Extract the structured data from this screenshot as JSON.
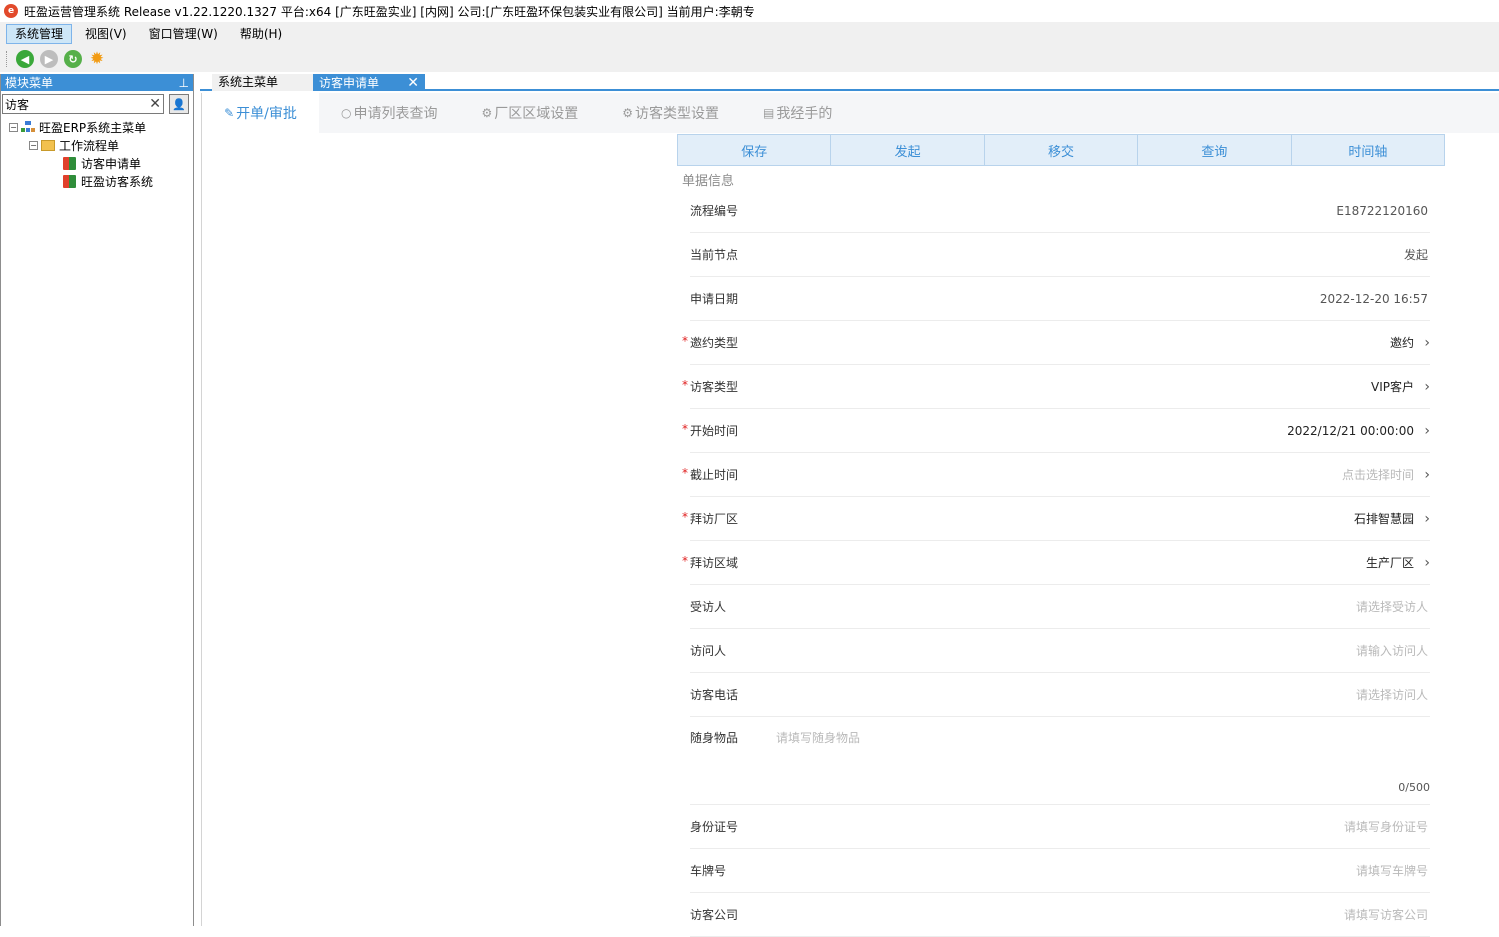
{
  "window": {
    "title": "旺盈运营管理系统 Release v1.22.1220.1327 平台:x64  [广东旺盈实业] [内网] 公司:[广东旺盈环保包装实业有限公司] 当前用户:李朝专"
  },
  "menubar": {
    "items": [
      "系统管理",
      "视图(V)",
      "窗口管理(W)",
      "帮助(H)"
    ]
  },
  "toolbar": {
    "icons": [
      "back-icon",
      "forward-icon",
      "refresh-icon",
      "gear-icon"
    ]
  },
  "left_panel": {
    "title": "模块菜单",
    "pin_glyph": "ᵽ",
    "search_value": "访客",
    "tree": {
      "root": "旺盈ERP系统主菜单",
      "folder": "工作流程单",
      "items": [
        "访客申请单",
        "旺盈访客系统"
      ]
    }
  },
  "doc_tabs": [
    "系统主菜单",
    "访客申请单"
  ],
  "subnav": [
    "开单/审批",
    "申请列表查询",
    "厂区区域设置",
    "访客类型设置",
    "我经手的"
  ],
  "actions": [
    "保存",
    "发起",
    "移交",
    "查询",
    "时间轴"
  ],
  "section_title": "单据信息",
  "form": {
    "flow_no": {
      "label": "流程编号",
      "value": "E18722120160"
    },
    "node": {
      "label": "当前节点",
      "value": "发起"
    },
    "apply_date": {
      "label": "申请日期",
      "value": "2022-12-20 16:57"
    },
    "invite_type": {
      "label": "邀约类型",
      "value": "邀约"
    },
    "visitor_type": {
      "label": "访客类型",
      "value": "VIP客户"
    },
    "start_time": {
      "label": "开始时间",
      "value": "2022/12/21 00:00:00"
    },
    "end_time": {
      "label": "截止时间",
      "placeholder": "点击选择时间"
    },
    "factory": {
      "label": "拜访厂区",
      "value": "石排智慧园"
    },
    "area": {
      "label": "拜访区域",
      "value": "生产厂区"
    },
    "host": {
      "label": "受访人",
      "placeholder": "请选择受访人"
    },
    "visitor": {
      "label": "访问人",
      "placeholder": "请输入访问人"
    },
    "phone": {
      "label": "访客电话",
      "placeholder": "请选择访问人"
    },
    "belongings": {
      "label": "随身物品",
      "placeholder": "请填写随身物品",
      "counter": "0/500"
    },
    "id_no": {
      "label": "身份证号",
      "placeholder": "请填写身份证号"
    },
    "plate": {
      "label": "车牌号",
      "placeholder": "请填写车牌号"
    },
    "company": {
      "label": "访客公司",
      "placeholder": "请填写访客公司"
    }
  },
  "colors": {
    "accent": "#3c8fd6",
    "required": "#e02020"
  }
}
